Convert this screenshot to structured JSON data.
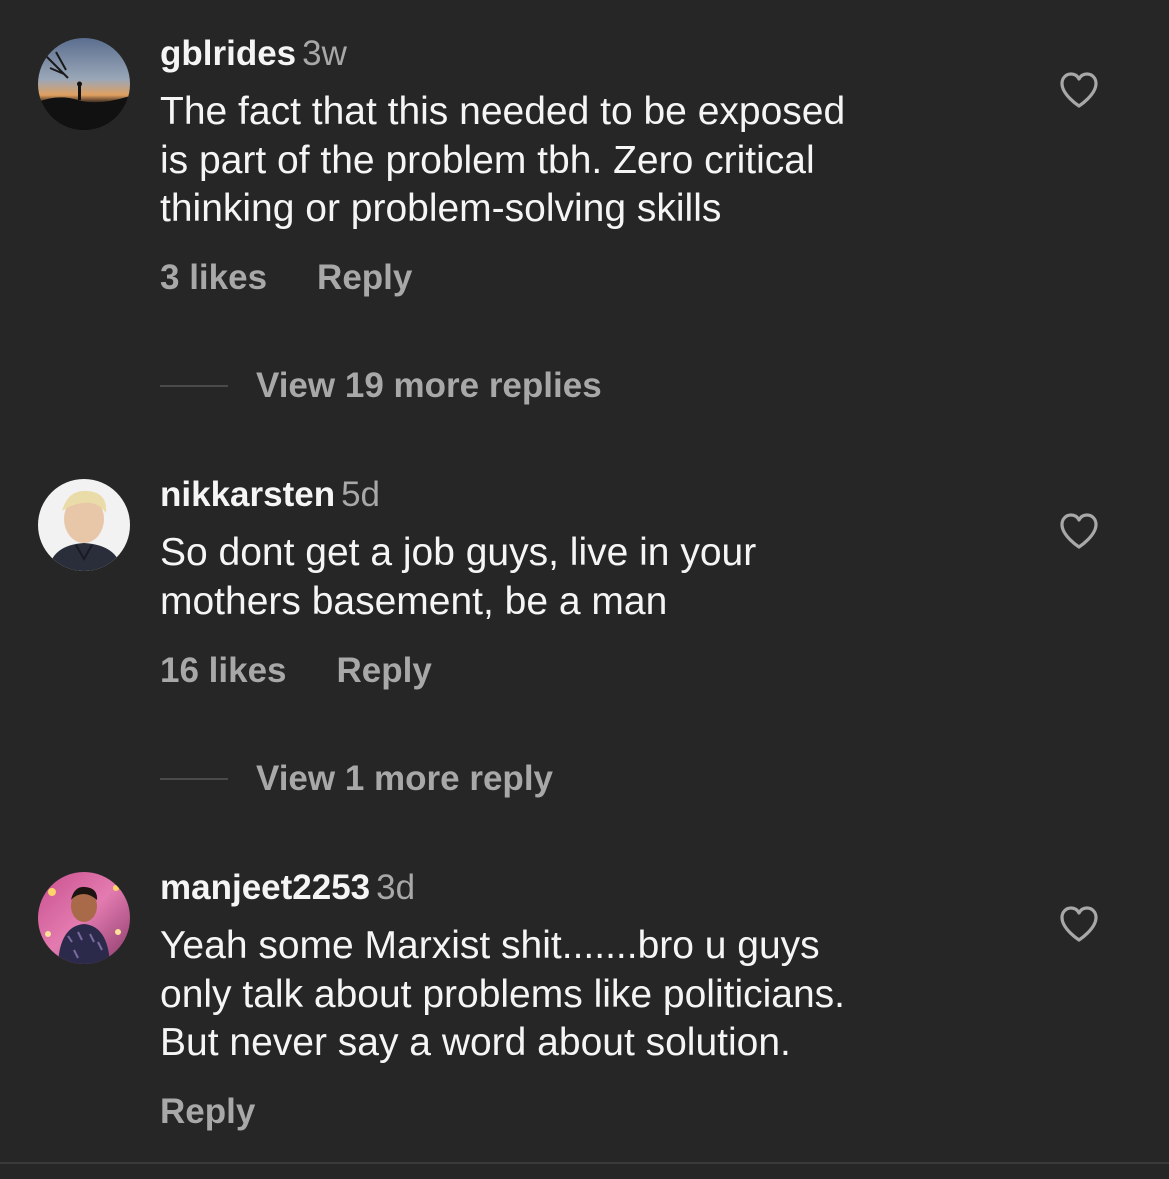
{
  "comments": [
    {
      "username": "gblrides",
      "time": "3w",
      "text_lines": [
        "The fact that this needed to be exposed",
        "is part of the problem tbh. Zero critical",
        "thinking or problem-solving skills"
      ],
      "likes": "3 likes",
      "reply_label": "Reply",
      "view_replies": "View 19 more replies",
      "avatar": "sunset-silhouette-avatar"
    },
    {
      "username": "nikkarsten",
      "time": "5d",
      "text_lines": [
        "So dont get a job guys, live in your",
        "mothers basement, be a man"
      ],
      "likes": "16 likes",
      "reply_label": "Reply",
      "view_replies": "View 1 more reply",
      "avatar": "person-portrait-avatar"
    },
    {
      "username": "manjeet2253",
      "time": "3d",
      "text_lines": [
        "Yeah some Marxist shit.......bro u guys",
        "only talk about problems like politicians.",
        "But never say a word about solution."
      ],
      "reply_label": "Reply",
      "avatar": "person-portrait-avatar"
    }
  ],
  "icons": {
    "like": "heart-outline-icon"
  },
  "colors": {
    "background": "#262626",
    "primary_text": "#f5f5f5",
    "secondary_text": "#a8a8a8"
  }
}
